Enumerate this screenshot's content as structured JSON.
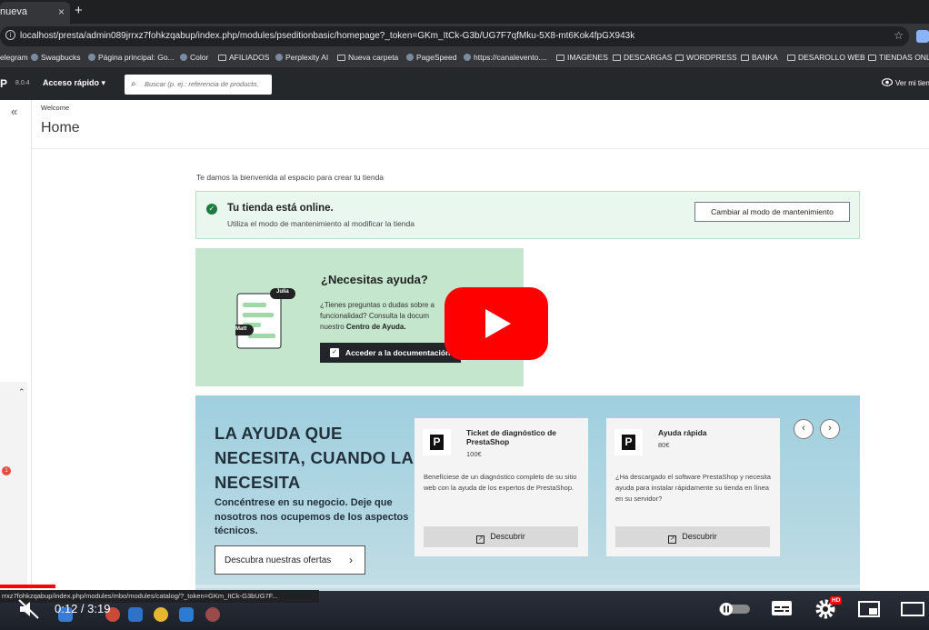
{
  "browser": {
    "tab_title": "nueva",
    "tab_close": "×",
    "new_tab": "+",
    "url": "localhost/presta/admin089jrrxz7fohkzqabup/index.php/modules/pseditionbasic/homepage?_token=GKm_ItCk-G3b/UG7F7qfMku-5X8-mt6Kok4fpGX943k",
    "star": "☆",
    "bookmarks": [
      "elegram",
      "Swagbucks",
      "Página principal: Go...",
      "Color",
      "AFILIADOS",
      "Perplexity AI",
      "Nueva carpeta",
      "PageSpeed",
      "https://canalevento....",
      "IMAGENES",
      "DESCARGAS",
      "WORDPRESS",
      "BANKA",
      "DESAROLLO WEB",
      "TIENDAS ONLINE"
    ]
  },
  "ps_header": {
    "logo": "P",
    "version": "8.0.4",
    "quick_access": "Acceso rápido ▾",
    "search_placeholder": "Buscar (p. ej.: referencia de producto,",
    "view_shop": "Ver mi tienda"
  },
  "sidebar": {
    "collapse": "«",
    "caret": "⌃",
    "badge": "1"
  },
  "page": {
    "breadcrumb": "Welcome",
    "title": "Home",
    "welcome": "Te damos la bienvenida al espacio para crear tu tienda"
  },
  "online": {
    "title": "Tu tienda está online.",
    "subtitle": "Utiliza el modo de mantenimiento al modificar la tienda",
    "button": "Cambiar al modo de mantenimiento"
  },
  "help": {
    "title": "¿Necesitas ayuda?",
    "text_line1": "¿Tienes preguntas o dudas sobre a",
    "text_line2": "funcionalidad? Consulta la docum",
    "text_line3_prefix": "nuestro ",
    "text_line3_bold": "Centro de Ayuda.",
    "button": "Acceder a la documentación",
    "bubble1": "Julia",
    "bubble2": "Matt"
  },
  "offers": {
    "title": "LA AYUDA QUE NECESITA, CUANDO LA NECESITA",
    "subtitle": "Concéntrese en su negocio. Deje que nosotros nos ocupemos de los aspectos técnicos.",
    "button": "Descubra nuestras ofertas",
    "button_arrow": "›",
    "prev": "‹",
    "next": "›",
    "cards": [
      {
        "title": "Ticket de diagnóstico de PrestaShop",
        "price": "100€",
        "desc": "Benefíciese de un diagnóstico completo de su sitio web con la ayuda de los expertos de PrestaShop.",
        "button": "Descubrir"
      },
      {
        "title": "Ayuda rápida",
        "price": "80€",
        "desc": "¿Ha descargado el software PrestaShop y necesita ayuda para instalar rápidamente su tienda en línea en su servidor?",
        "button": "Descubrir"
      }
    ]
  },
  "status_bar": {
    "url": "rrxz7fohkzqabup/index.php/modules/mbo/modules/catalog/?_token=GKm_ItCk-G3bUG7F..."
  },
  "player": {
    "time": "0:12 / 3:19",
    "progress_fraction": 0.06,
    "hd_badge": "HD",
    "accent": "#ff0000"
  }
}
